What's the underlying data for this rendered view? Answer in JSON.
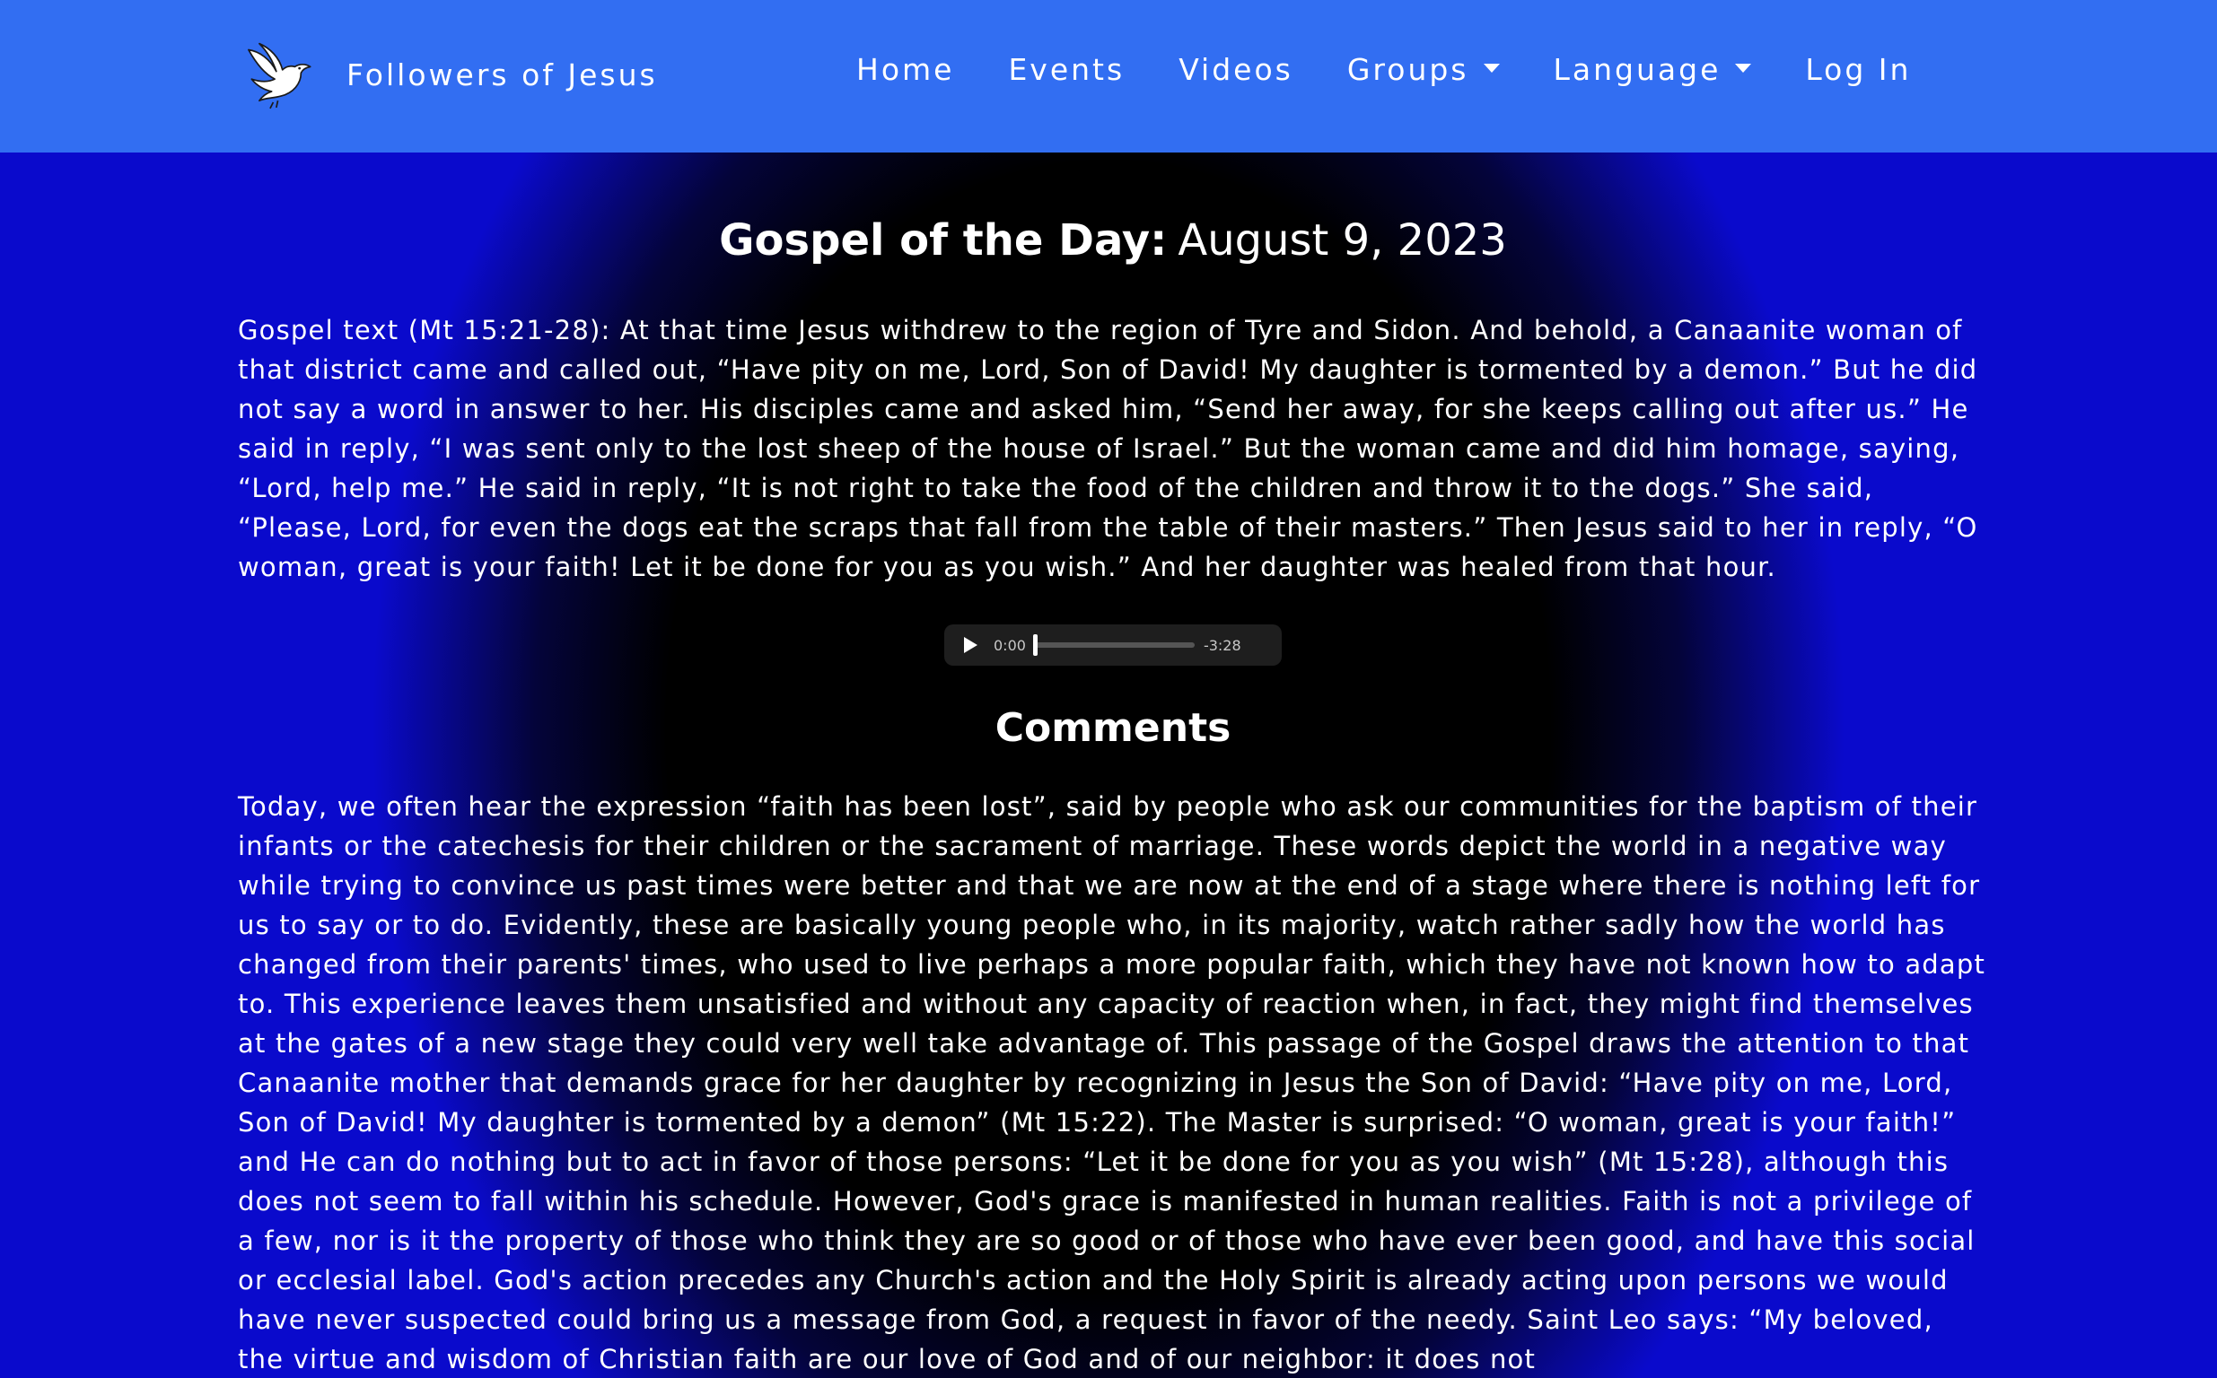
{
  "navbar": {
    "brand_name": "Followers of Jesus",
    "logo_icon": "dove-icon",
    "background_color": "#326ef2",
    "items": [
      {
        "label": "Home",
        "dropdown": false
      },
      {
        "label": "Events",
        "dropdown": false
      },
      {
        "label": "Videos",
        "dropdown": false
      },
      {
        "label": "Groups",
        "dropdown": true
      },
      {
        "label": "Language",
        "dropdown": true
      },
      {
        "label": "Log In",
        "dropdown": false
      }
    ]
  },
  "page": {
    "title_strong": "Gospel of the Day:",
    "title_date": "August 9, 2023",
    "gospel_text": "Gospel text (Mt 15:21-28): At that time Jesus withdrew to the region of Tyre and Sidon. And behold, a Canaanite woman of that district came and called out, “Have pity on me, Lord, Son of David! My daughter is tormented by a demon.” But he did not say a word in answer to her. His disciples came and asked him, “Send her away, for she keeps calling out after us.” He said in reply, “I was sent only to the lost sheep of the house of Israel.” But the woman came and did him homage, saying, “Lord, help me.” He said in reply, “It is not right to take the food of the children and throw it to the dogs.” She said, “Please, Lord, for even the dogs eat the scraps that fall from the table of their masters.” Then Jesus said to her in reply, “O woman, great is your faith! Let it be done for you as you wish.” And her daughter was healed from that hour.",
    "comments_heading": "Comments",
    "comments_text": "Today, we often hear the expression “faith has been lost”, said by people who ask our communities for the baptism of their infants or the catechesis for their children or the sacrament of marriage. These words depict the world in a negative way while trying to convince us past times were better and that we are now at the end of a stage where there is nothing left for us to say or to do. Evidently, these are basically young people who, in its majority, watch rather sadly how the world has changed from their parents' times, who used to live perhaps a more popular faith, which they have not known how to adapt to. This experience leaves them unsatisfied and without any capacity of reaction when, in fact, they might find themselves at the gates of a new stage they could very well take advantage of. This passage of the Gospel draws the attention to that Canaanite mother that demands grace for her daughter by recognizing in Jesus the Son of David: “Have pity on me, Lord, Son of David! My daughter is tormented by a demon” (Mt 15:22). The Master is surprised: “O woman, great is your faith!” and He can do nothing but to act in favor of those persons: “Let it be done for you as you wish” (Mt 15:28), although this does not seem to fall within his schedule. However, God's grace is manifested in human realities. Faith is not a privilege of a few, nor is it the property of those who think they are so good or of those who have ever been good, and have this social or ecclesial label. God's action precedes any Church's action and the Holy Spirit is already acting upon persons we would have never suspected could bring us a message from God, a request in favor of the needy. Saint Leo says: “My beloved, the virtue and wisdom of Christian faith are our love of God and of our neighbor: it does not"
  },
  "audio": {
    "current_time": "0:00",
    "remaining_time": "-3:28",
    "progress": 0,
    "play_icon": "play-icon"
  }
}
